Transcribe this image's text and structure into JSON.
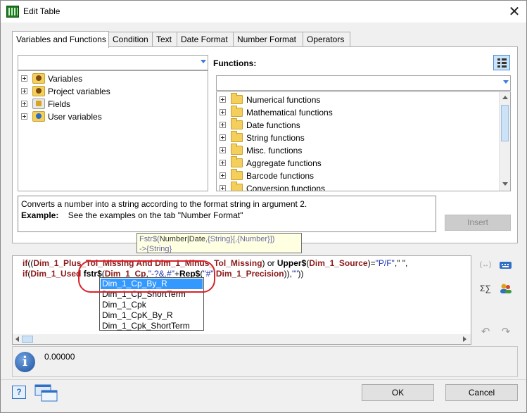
{
  "window": {
    "title": "Edit Table",
    "close_glyph": "✕"
  },
  "tabs": [
    "Variables and Functions",
    "Condition",
    "Text",
    "Date Format",
    "Number Format",
    "Operators"
  ],
  "left_tree": {
    "items": [
      "Variables",
      "Project variables",
      "Fields",
      "User variables"
    ]
  },
  "functions": {
    "label": "Functions:",
    "items": [
      "Numerical functions",
      "Mathematical functions",
      "Date functions",
      "String functions",
      "Misc. functions",
      "Aggregate functions",
      "Barcode functions",
      "Conversion functions"
    ]
  },
  "description": {
    "line1": "Converts a number into a string according to the format string in argument 2.",
    "example_label": "Example:",
    "example_text": "See the examples on the tab \"Number Format\""
  },
  "insert_button": "Insert",
  "tooltip": {
    "prefix": "Fstr$(",
    "arg1": "Number|Date",
    "rest": ",{String}[,{Number}])",
    "line2": "->{String}"
  },
  "code": {
    "l1": {
      "if": "if",
      "p1": "((",
      "a": "Dim_1_Plus_Tol_Missing",
      "and": " And ",
      "b": "Dim_1_Minus_Tol_Missing",
      "p2": ") or ",
      "upper": "Upper$",
      "p3": "(",
      "c": "Dim_1_Source",
      "p4": ")=",
      "s1": "\"P/F\"",
      "p5": ",\" \","
    },
    "l2": {
      "if": "if",
      "p1": "(",
      "a": "Dim_1_Used",
      "fstr": "fstr$",
      "p2": "(",
      "b": "Dim_1_Cp",
      "p3": ",",
      "s1": "\"-?&.#\"",
      "p4": "+",
      "rep": "Rep$",
      "p5": "(",
      "s2": "\"#\"",
      "p6": ",",
      "c": "Dim_1_Precision",
      "p7": ")),",
      "s3": "\"\"",
      "p8": "))"
    }
  },
  "autocomplete": [
    "Dim_1_Cp_By_R",
    "Dim_1_Cp_ShortTerm",
    "Dim_1_Cpk",
    "Dim_1_CpK_By_R",
    "Dim_1_Cpk_ShortTerm"
  ],
  "result": {
    "value": "0.00000",
    "info_glyph": "i"
  },
  "buttons": {
    "ok": "OK",
    "cancel": "Cancel"
  },
  "side_icons": {
    "wrap": "(↔)",
    "sum": "Σ∑",
    "undo": "↶",
    "redo": "↷",
    "help": "?"
  }
}
